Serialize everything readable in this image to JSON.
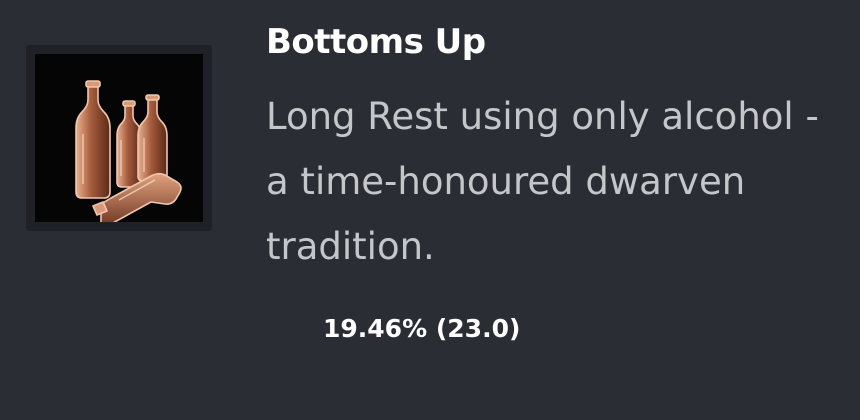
{
  "achievement": {
    "title": "Bottoms Up",
    "description": "Long Rest using only alcohol - a time-honoured dwarven tradition.",
    "rarity_percent": "19.46%",
    "rarity_score": "(23.0)",
    "icon": "bottles-icon"
  },
  "colors": {
    "background": "#2a2d33",
    "title": "#ffffff",
    "description": "#c4c6ca",
    "icon_accent": "#c98a68"
  }
}
